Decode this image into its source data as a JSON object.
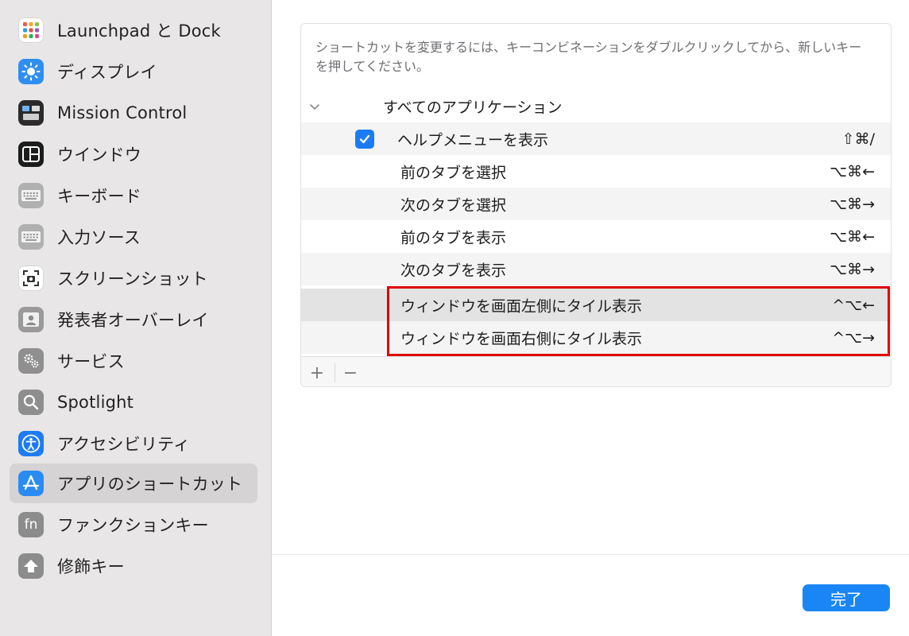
{
  "sidebar": {
    "items": [
      {
        "label": "Launchpad と Dock",
        "icon": "launchpad-icon"
      },
      {
        "label": "ディスプレイ",
        "icon": "display-icon"
      },
      {
        "label": "Mission Control",
        "icon": "mission-control-icon"
      },
      {
        "label": "ウインドウ",
        "icon": "window-icon"
      },
      {
        "label": "キーボード",
        "icon": "keyboard-icon"
      },
      {
        "label": "入力ソース",
        "icon": "input-source-icon"
      },
      {
        "label": "スクリーンショット",
        "icon": "screenshot-icon"
      },
      {
        "label": "発表者オーバーレイ",
        "icon": "presenter-overlay-icon"
      },
      {
        "label": "サービス",
        "icon": "services-icon"
      },
      {
        "label": "Spotlight",
        "icon": "spotlight-icon"
      },
      {
        "label": "アクセシビリティ",
        "icon": "accessibility-icon"
      },
      {
        "label": "アプリのショートカット",
        "icon": "app-shortcuts-icon",
        "selected": true
      },
      {
        "label": "ファンクションキー",
        "icon": "function-keys-icon",
        "icon_text": "fn"
      },
      {
        "label": "修飾キー",
        "icon": "modifier-keys-icon"
      }
    ]
  },
  "main": {
    "description": "ショートカットを変更するには、キーコンビネーションをダブルクリックしてから、新しいキーを押してください。",
    "group": {
      "label": "すべてのアプリケーション",
      "expanded": true
    },
    "rows": [
      {
        "label": "ヘルプメニューを表示",
        "shortcut": "⇧⌘/",
        "checked": true
      },
      {
        "label": "前のタブを選択",
        "shortcut": "⌥⌘←"
      },
      {
        "label": "次のタブを選択",
        "shortcut": "⌥⌘→"
      },
      {
        "label": "前のタブを表示",
        "shortcut": "⌥⌘←"
      },
      {
        "label": "次のタブを表示",
        "shortcut": "⌥⌘→"
      },
      {
        "label": "ウィンドウを画面左側にタイル表示",
        "shortcut": "^⌥←"
      },
      {
        "label": "ウィンドウを画面右側にタイル表示",
        "shortcut": "^⌥→"
      }
    ],
    "add_label": "+",
    "remove_label": "−",
    "done_label": "完了"
  },
  "colors": {
    "accent": "#1a86f6",
    "highlight_border": "#e00000",
    "sidebar_bg": "#e8e6e6"
  }
}
